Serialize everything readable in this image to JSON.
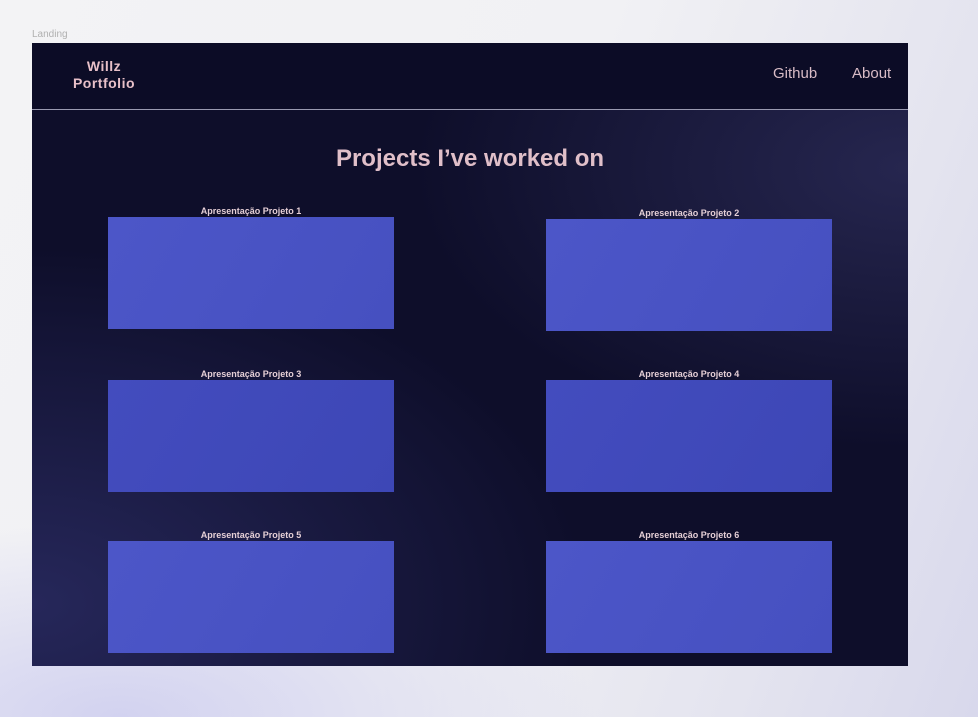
{
  "frame_label": "Landing",
  "nav": {
    "logo_line1": "Willz",
    "logo_line2": "Portfolio",
    "links": [
      "Github",
      "About"
    ]
  },
  "title": "Projects I’ve worked on",
  "projects": [
    "Apresentação Projeto 1",
    "Apresentação Projeto 2",
    "Apresentação Projeto 3",
    "Apresentação Projeto 4",
    "Apresentação Projeto 5",
    "Apresentação Projeto 6"
  ]
}
